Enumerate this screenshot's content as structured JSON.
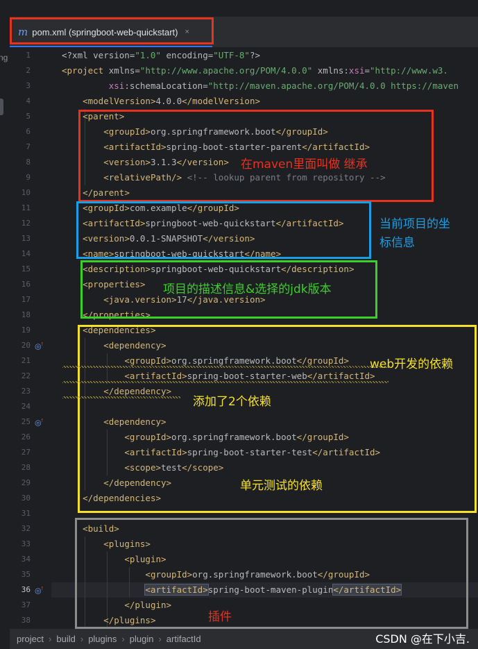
{
  "sidebar": {
    "clipped_text": "ng"
  },
  "tab": {
    "icon": "m",
    "title": "pom.xml (springboot-web-quickstart)",
    "close": "×"
  },
  "code_lines": [
    [
      {
        "c": "a",
        "t": "<?xml version="
      },
      {
        "c": "s",
        "t": "\"1.0\""
      },
      {
        "c": "a",
        "t": " encoding="
      },
      {
        "c": "s",
        "t": "\"UTF-8\""
      },
      {
        "c": "a",
        "t": "?>"
      }
    ],
    [
      {
        "c": "t",
        "t": "<project "
      },
      {
        "c": "a",
        "t": "xmlns="
      },
      {
        "c": "s",
        "t": "\"http://www.apache.org/POM/4.0.0\" "
      },
      {
        "c": "a",
        "t": "xmlns:"
      },
      {
        "c": "ns",
        "t": "xsi"
      },
      {
        "c": "a",
        "t": "="
      },
      {
        "c": "s",
        "t": "\"http://www.w3."
      }
    ],
    [
      {
        "c": "a",
        "t": "         "
      },
      {
        "c": "ns",
        "t": "xsi"
      },
      {
        "c": "a",
        "t": ":schemaLocation="
      },
      {
        "c": "s",
        "t": "\"http://maven.apache.org/POM/4.0.0 https://maven"
      }
    ],
    [
      {
        "c": "a",
        "t": "    "
      },
      {
        "c": "t",
        "t": "<modelVersion>"
      },
      {
        "c": "a",
        "t": "4.0.0"
      },
      {
        "c": "t",
        "t": "</modelVersion>"
      }
    ],
    [
      {
        "c": "a",
        "t": "    "
      },
      {
        "c": "t",
        "t": "<parent>"
      }
    ],
    [
      {
        "c": "a",
        "t": "        "
      },
      {
        "c": "t",
        "t": "<groupId>"
      },
      {
        "c": "a",
        "t": "org.springframework.boot"
      },
      {
        "c": "t",
        "t": "</groupId>"
      }
    ],
    [
      {
        "c": "a",
        "t": "        "
      },
      {
        "c": "t",
        "t": "<artifactId>"
      },
      {
        "c": "a",
        "t": "spring-boot-starter-parent"
      },
      {
        "c": "t",
        "t": "</artifactId>"
      }
    ],
    [
      {
        "c": "a",
        "t": "        "
      },
      {
        "c": "t",
        "t": "<version>"
      },
      {
        "c": "a",
        "t": "3.1.3"
      },
      {
        "c": "t",
        "t": "</version>"
      }
    ],
    [
      {
        "c": "a",
        "t": "        "
      },
      {
        "c": "t",
        "t": "<relativePath/>"
      },
      {
        "c": "c",
        "t": " <!-- lookup parent from repository -->"
      }
    ],
    [
      {
        "c": "a",
        "t": "    "
      },
      {
        "c": "t",
        "t": "</parent>"
      }
    ],
    [
      {
        "c": "a",
        "t": "    "
      },
      {
        "c": "t",
        "t": "<groupId>"
      },
      {
        "c": "a",
        "t": "com.example"
      },
      {
        "c": "t",
        "t": "</groupId>"
      }
    ],
    [
      {
        "c": "a",
        "t": "    "
      },
      {
        "c": "t",
        "t": "<artifactId>"
      },
      {
        "c": "a",
        "t": "springboot-web-quickstart"
      },
      {
        "c": "t",
        "t": "</artifactId>"
      }
    ],
    [
      {
        "c": "a",
        "t": "    "
      },
      {
        "c": "t",
        "t": "<version>"
      },
      {
        "c": "a",
        "t": "0.0.1-SNAPSHOT"
      },
      {
        "c": "t",
        "t": "</version>"
      }
    ],
    [
      {
        "c": "a",
        "t": "    "
      },
      {
        "c": "t",
        "t": "<name>"
      },
      {
        "c": "a",
        "t": "springboot-web-quickstart"
      },
      {
        "c": "t",
        "t": "</name>"
      }
    ],
    [
      {
        "c": "a",
        "t": "    "
      },
      {
        "c": "t",
        "t": "<description>"
      },
      {
        "c": "a",
        "t": "springboot-web-quickstart"
      },
      {
        "c": "t",
        "t": "</description>"
      }
    ],
    [
      {
        "c": "a",
        "t": "    "
      },
      {
        "c": "t",
        "t": "<properties>"
      }
    ],
    [
      {
        "c": "a",
        "t": "        "
      },
      {
        "c": "t",
        "t": "<java.version>"
      },
      {
        "c": "a",
        "t": "17"
      },
      {
        "c": "t",
        "t": "</java.version>"
      }
    ],
    [
      {
        "c": "a",
        "t": "    "
      },
      {
        "c": "t",
        "t": "</properties>"
      }
    ],
    [
      {
        "c": "a",
        "t": "    "
      },
      {
        "c": "t",
        "t": "<dependencies>"
      }
    ],
    [
      {
        "c": "a",
        "t": "        "
      },
      {
        "c": "t",
        "t": "<dependency>"
      }
    ],
    [
      {
        "c": "a",
        "t": "            "
      },
      {
        "c": "t",
        "t": "<groupId>"
      },
      {
        "c": "a",
        "t": "org.springframework.boot"
      },
      {
        "c": "t",
        "t": "</groupId>"
      }
    ],
    [
      {
        "c": "a",
        "t": "            "
      },
      {
        "c": "t",
        "t": "<artifactId>"
      },
      {
        "c": "a",
        "t": "spring-boot-starter-web"
      },
      {
        "c": "t",
        "t": "</artifactId>"
      }
    ],
    [
      {
        "c": "a",
        "t": "        "
      },
      {
        "c": "t",
        "t": "</dependency>"
      }
    ],
    [],
    [
      {
        "c": "a",
        "t": "        "
      },
      {
        "c": "t",
        "t": "<dependency>"
      }
    ],
    [
      {
        "c": "a",
        "t": "            "
      },
      {
        "c": "t",
        "t": "<groupId>"
      },
      {
        "c": "a",
        "t": "org.springframework.boot"
      },
      {
        "c": "t",
        "t": "</groupId>"
      }
    ],
    [
      {
        "c": "a",
        "t": "            "
      },
      {
        "c": "t",
        "t": "<artifactId>"
      },
      {
        "c": "a",
        "t": "spring-boot-starter-test"
      },
      {
        "c": "t",
        "t": "</artifactId>"
      }
    ],
    [
      {
        "c": "a",
        "t": "            "
      },
      {
        "c": "t",
        "t": "<scope>"
      },
      {
        "c": "a",
        "t": "test"
      },
      {
        "c": "t",
        "t": "</scope>"
      }
    ],
    [
      {
        "c": "a",
        "t": "        "
      },
      {
        "c": "t",
        "t": "</dependency>"
      }
    ],
    [
      {
        "c": "a",
        "t": "    "
      },
      {
        "c": "t",
        "t": "</dependencies>"
      }
    ],
    [],
    [
      {
        "c": "a",
        "t": "    "
      },
      {
        "c": "t",
        "t": "<build>"
      }
    ],
    [
      {
        "c": "a",
        "t": "        "
      },
      {
        "c": "t",
        "t": "<plugins>"
      }
    ],
    [
      {
        "c": "a",
        "t": "            "
      },
      {
        "c": "t",
        "t": "<plugin>"
      }
    ],
    [
      {
        "c": "a",
        "t": "                "
      },
      {
        "c": "t",
        "t": "<groupId>"
      },
      {
        "c": "a",
        "t": "org.springframework.boot"
      },
      {
        "c": "t",
        "t": "</groupId>"
      }
    ],
    [
      {
        "c": "a",
        "t": "                "
      },
      {
        "c": "t hl",
        "t": "<artifactId>"
      },
      {
        "c": "a",
        "t": "spring-boot-maven-plugin"
      },
      {
        "c": "t hl",
        "t": "</artifactId>"
      },
      {
        "c": "caret",
        "t": ""
      }
    ],
    [
      {
        "c": "a",
        "t": "            "
      },
      {
        "c": "t",
        "t": "</plugin>"
      }
    ],
    [
      {
        "c": "a",
        "t": "        "
      },
      {
        "c": "t",
        "t": "</plugins>"
      }
    ]
  ],
  "current_line": 36,
  "gutter_icon_lines": [
    20,
    25,
    36
  ],
  "gutter_icon_glyph": "◎",
  "gutter_icon_up": "↑",
  "annotations": {
    "parent_note": "在maven里面叫做 继承",
    "coords_note": "当前项目的坐\n标信息",
    "desc_note": "项目的描述信息&选择的jdk版本",
    "web_dep_note": "web开发的依赖",
    "added_note": "添加了2个依赖",
    "test_dep_note": "单元测试的依赖",
    "plugin_note": "插件"
  },
  "colors": {
    "red": "#e8321f",
    "blue": "#1a9fe6",
    "green": "#3ccf2a",
    "yellow": "#f5e12a",
    "gray": "#8c8c8c",
    "tag": "#d5b778",
    "string": "#6aab73",
    "comment": "#7a7e85"
  },
  "breadcrumb": [
    "project",
    "build",
    "plugins",
    "plugin",
    "artifactId"
  ],
  "watermark": "CSDN @在下小吉."
}
